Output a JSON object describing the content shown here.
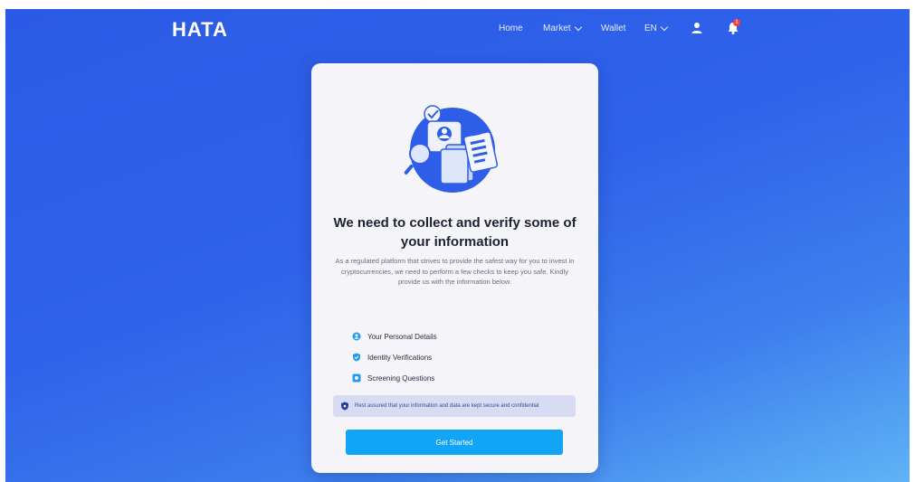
{
  "brand": {
    "logo_text": "HATA"
  },
  "nav": {
    "home": "Home",
    "market": "Market",
    "wallet": "Wallet",
    "language": "EN",
    "notification_count": "1"
  },
  "card": {
    "title": "We need to collect and verify some of your information",
    "description": "As a regulated platform that strives to provide the safest way for you to invest in cryptocurrencies, we need to perform a few checks to keep you safe. Kindly provide us with the information below.",
    "steps": [
      {
        "label": "Your Personal Details",
        "icon": "user-circle-icon"
      },
      {
        "label": "Identity Verifications",
        "icon": "shield-check-icon"
      },
      {
        "label": "Screening Questions",
        "icon": "question-icon"
      }
    ],
    "security_note": "Rest assured that your information and data are kept secure and confidential",
    "cta_label": "Get Started"
  },
  "colors": {
    "accent": "#12a4f5",
    "background_start": "#2c5ae6",
    "background_end": "#5fb3f5",
    "badge": "#ff3b3b"
  }
}
